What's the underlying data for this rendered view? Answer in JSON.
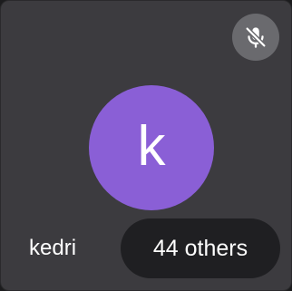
{
  "participant": {
    "initial": "k",
    "name": "kedri",
    "avatar_color": "#8a5fd6",
    "mic_state": "muted",
    "mic_icon": "mic-off-icon"
  },
  "others_button": {
    "label": "44 others"
  },
  "colors": {
    "tile_background": "#3c3b3f",
    "pill_background": "#1f1f22",
    "mute_badge": "#6a6a6e"
  }
}
